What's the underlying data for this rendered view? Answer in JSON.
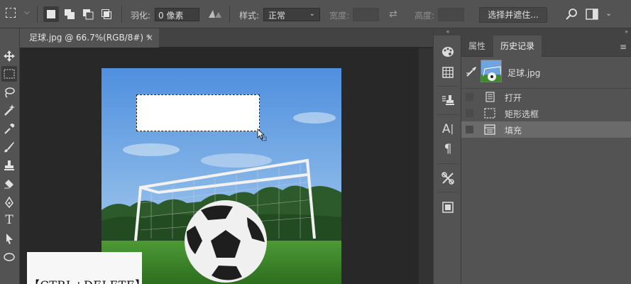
{
  "options_bar": {
    "feather_label": "羽化:",
    "feather_value": "0 像素",
    "style_label": "样式:",
    "style_value": "正常",
    "width_label": "宽度:",
    "height_label": "高度:",
    "select_mask_button": "选择并遮住..."
  },
  "document_tab": {
    "title": "足球.jpg @ 66.7%(RGB/8#) *",
    "close": "×"
  },
  "panel": {
    "tabs": [
      "属性",
      "历史记录"
    ],
    "active_tab": "历史记录",
    "snapshot_name": "足球.jpg",
    "history": [
      {
        "name": "打开",
        "icon": "document-icon"
      },
      {
        "name": "矩形选框",
        "icon": "marquee-icon"
      },
      {
        "name": "填充",
        "icon": "fill-icon"
      }
    ]
  },
  "hint_text": "【CTRL+DELETE】",
  "colors": {
    "ui_gray": "#535353",
    "dark_bg": "#282828",
    "sky": "#6e9fdc",
    "grass": "#3f8a2c"
  }
}
